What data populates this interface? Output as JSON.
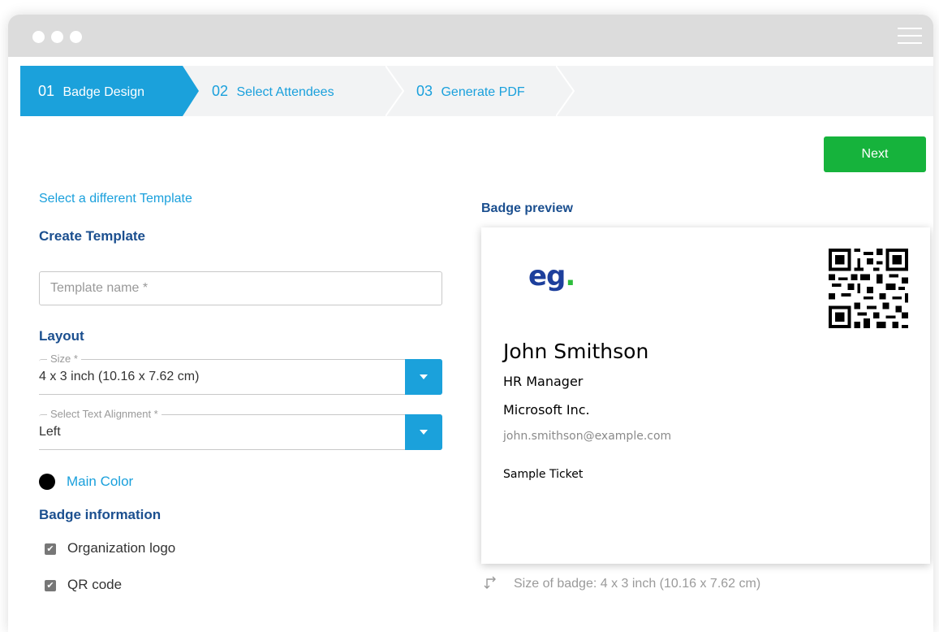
{
  "steps": [
    {
      "num": "01",
      "label": "Badge Design"
    },
    {
      "num": "02",
      "label": "Select Attendees"
    },
    {
      "num": "03",
      "label": "Generate PDF"
    }
  ],
  "toolbar": {
    "next_label": "Next"
  },
  "left": {
    "select_template_link": "Select a different Template",
    "create_template_heading": "Create Template",
    "template_name_placeholder": "Template name *",
    "layout_heading": "Layout",
    "size_legend": "Size *",
    "size_value": "4 x 3 inch (10.16 x 7.62 cm)",
    "alignment_legend": "Select Text Alignment *",
    "alignment_value": "Left",
    "main_color_label": "Main Color",
    "main_color": "#000000",
    "badge_info_heading": "Badge information",
    "options": [
      {
        "label": "Organization logo",
        "checked": true
      },
      {
        "label": "QR code",
        "checked": true
      }
    ]
  },
  "preview": {
    "label": "Badge preview",
    "logo_text": "eg",
    "logo_dot": ".",
    "name": "John Smithson",
    "title": "HR Manager",
    "company": "Microsoft Inc.",
    "email": "john.smithson@example.com",
    "ticket": "Sample Ticket",
    "size_text": "Size of badge: 4 x 3 inch (10.16 x 7.62 cm)"
  },
  "colors": {
    "accent": "#1ba1db",
    "next": "#16b33c",
    "heading": "#1b4f8f",
    "logo": "#1d3f9c",
    "logo_dot": "#2dbd3c"
  },
  "icons": [
    "menu-icon",
    "qr-code-icon",
    "resize-icon",
    "chevron-down-icon",
    "checkmark-icon"
  ]
}
